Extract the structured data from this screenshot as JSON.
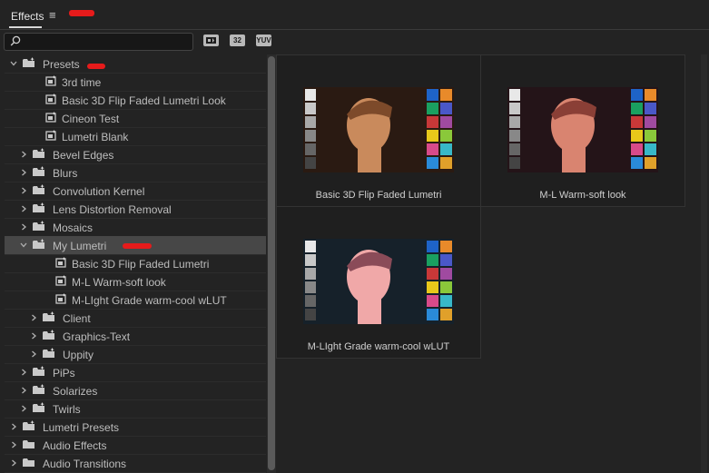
{
  "panel": {
    "title": "Effects",
    "menu_icon": "hamburger-icon"
  },
  "toolbar": {
    "search": {
      "value": "",
      "placeholder": ""
    },
    "filters": [
      {
        "label": "",
        "icon": "accelerated-effects-icon"
      },
      {
        "label": "32",
        "icon": "32-bit-icon"
      },
      {
        "label": "YUV",
        "icon": "yuv-icon"
      }
    ]
  },
  "tree": [
    {
      "label": "Presets",
      "kind": "folder",
      "depth": 0,
      "expanded": true
    },
    {
      "label": "3rd time",
      "kind": "preset",
      "depth": 1
    },
    {
      "label": "Basic 3D Flip Faded Lumetri Look",
      "kind": "preset",
      "depth": 1
    },
    {
      "label": "Cineon Test",
      "kind": "preset",
      "depth": 1
    },
    {
      "label": "Lumetri Blank",
      "kind": "preset",
      "depth": 1
    },
    {
      "label": "Bevel Edges",
      "kind": "folder",
      "depth": 1,
      "expanded": false
    },
    {
      "label": "Blurs",
      "kind": "folder",
      "depth": 1,
      "expanded": false
    },
    {
      "label": "Convolution Kernel",
      "kind": "folder",
      "depth": 1,
      "expanded": false
    },
    {
      "label": "Lens Distortion Removal",
      "kind": "folder",
      "depth": 1,
      "expanded": false
    },
    {
      "label": "Mosaics",
      "kind": "folder",
      "depth": 1,
      "expanded": false
    },
    {
      "label": "My Lumetri",
      "kind": "folder",
      "depth": 1,
      "expanded": true,
      "selected": true
    },
    {
      "label": "Basic 3D Flip Faded Lumetri",
      "kind": "preset",
      "depth": 2
    },
    {
      "label": "M-L Warm-soft look",
      "kind": "preset",
      "depth": 2
    },
    {
      "label": "M-LIght Grade warm-cool wLUT",
      "kind": "preset",
      "depth": 2
    },
    {
      "label": "Client",
      "kind": "folder",
      "depth": 2,
      "expanded": false
    },
    {
      "label": "Graphics-Text",
      "kind": "folder",
      "depth": 2,
      "expanded": false
    },
    {
      "label": "Uppity",
      "kind": "folder",
      "depth": 2,
      "expanded": false
    },
    {
      "label": "PiPs",
      "kind": "folder",
      "depth": 1,
      "expanded": false
    },
    {
      "label": "Solarizes",
      "kind": "folder",
      "depth": 1,
      "expanded": false
    },
    {
      "label": "Twirls",
      "kind": "folder",
      "depth": 1,
      "expanded": false
    },
    {
      "label": "Lumetri Presets",
      "kind": "folder",
      "depth": 0,
      "expanded": false
    },
    {
      "label": "Audio Effects",
      "kind": "folder-plain",
      "depth": 0,
      "expanded": false
    },
    {
      "label": "Audio Transitions",
      "kind": "folder-plain",
      "depth": 0,
      "expanded": false
    }
  ],
  "gallery": [
    {
      "label": "Basic 3D Flip Faded Lumetri",
      "tone": [
        "#2a1a12",
        "#c98a5c",
        "#7d4a2a"
      ]
    },
    {
      "label": "M-L Warm-soft look",
      "tone": [
        "#241418",
        "#d98470",
        "#8a3f36"
      ]
    },
    {
      "label": "M-LIght Grade warm-cool wLUT",
      "tone": [
        "#16212a",
        "#f0a8a8",
        "#8a4b58"
      ]
    }
  ],
  "colors": {
    "background": "#232323",
    "selected_row": "#474747",
    "redaction": "#e61b1b"
  }
}
